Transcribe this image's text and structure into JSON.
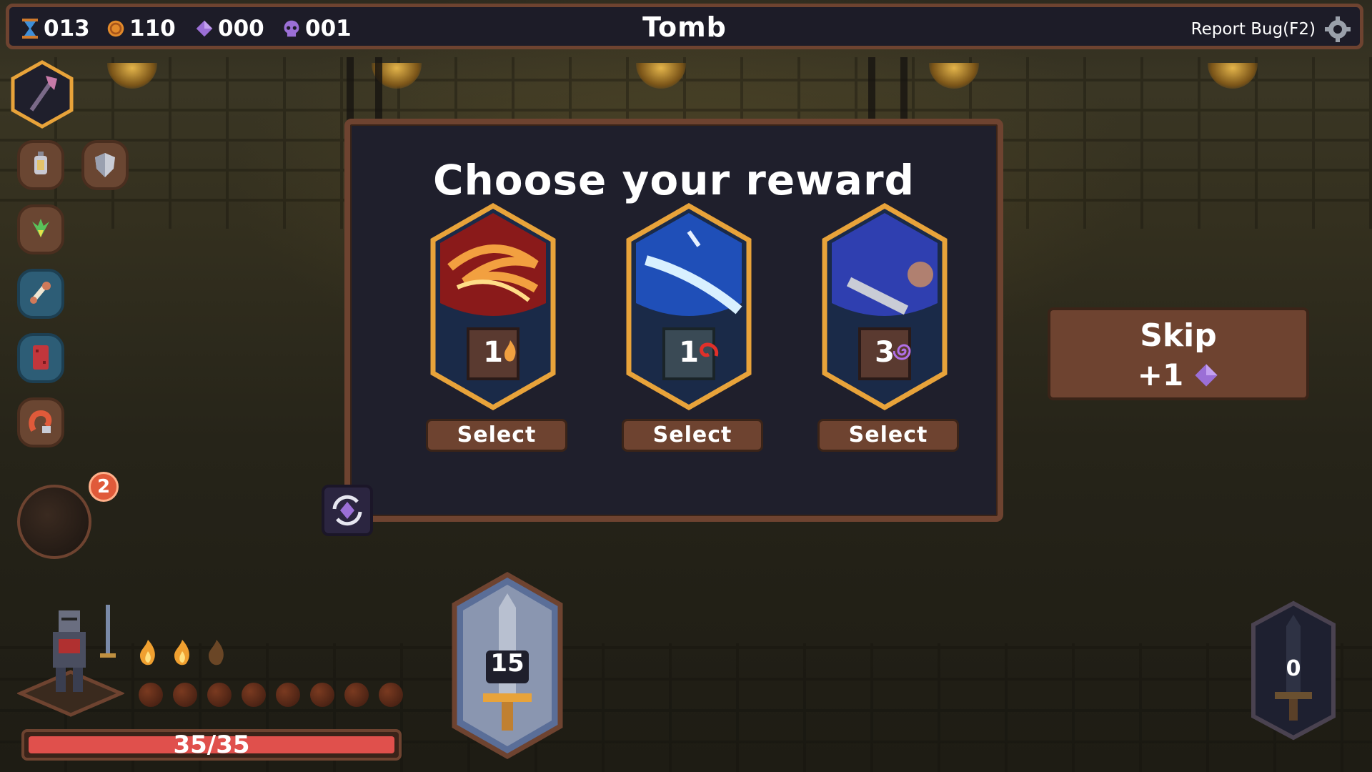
{
  "topbar": {
    "resources": [
      {
        "icon": "hourglass-icon",
        "value": "013"
      },
      {
        "icon": "coin-icon",
        "value": "110"
      },
      {
        "icon": "gem-icon",
        "value": "000"
      },
      {
        "icon": "skull-icon",
        "value": "001"
      }
    ],
    "title": "Tomb",
    "report_bug_label": "Report Bug(F2)"
  },
  "modal": {
    "title": "Choose your reward",
    "cards": [
      {
        "name": "fire-swirl",
        "cost": "1",
        "cost_icon": "fire-cost-icon",
        "select_label": "Select",
        "accent": "#c8352a"
      },
      {
        "name": "wind-slash",
        "cost": "1",
        "cost_icon": "rage-cost-icon",
        "select_label": "Select",
        "accent": "#3f79d6"
      },
      {
        "name": "storm-strike",
        "cost": "3",
        "cost_icon": "arcane-cost-icon",
        "select_label": "Select",
        "accent": "#3b57c4"
      }
    ]
  },
  "skip": {
    "label": "Skip",
    "reward": "+1"
  },
  "notification_count": "2",
  "player": {
    "hp": "35/35",
    "hp_fraction": 1.0,
    "flames_lit": 2,
    "flames_total": 3,
    "orbs": 8
  },
  "deck": {
    "draw_count": "15",
    "discard_count": "0"
  },
  "colors": {
    "frame": "#6e4330",
    "panel": "#1f1f2c",
    "gold": "#e8a33a",
    "hp": "#e0504c"
  }
}
